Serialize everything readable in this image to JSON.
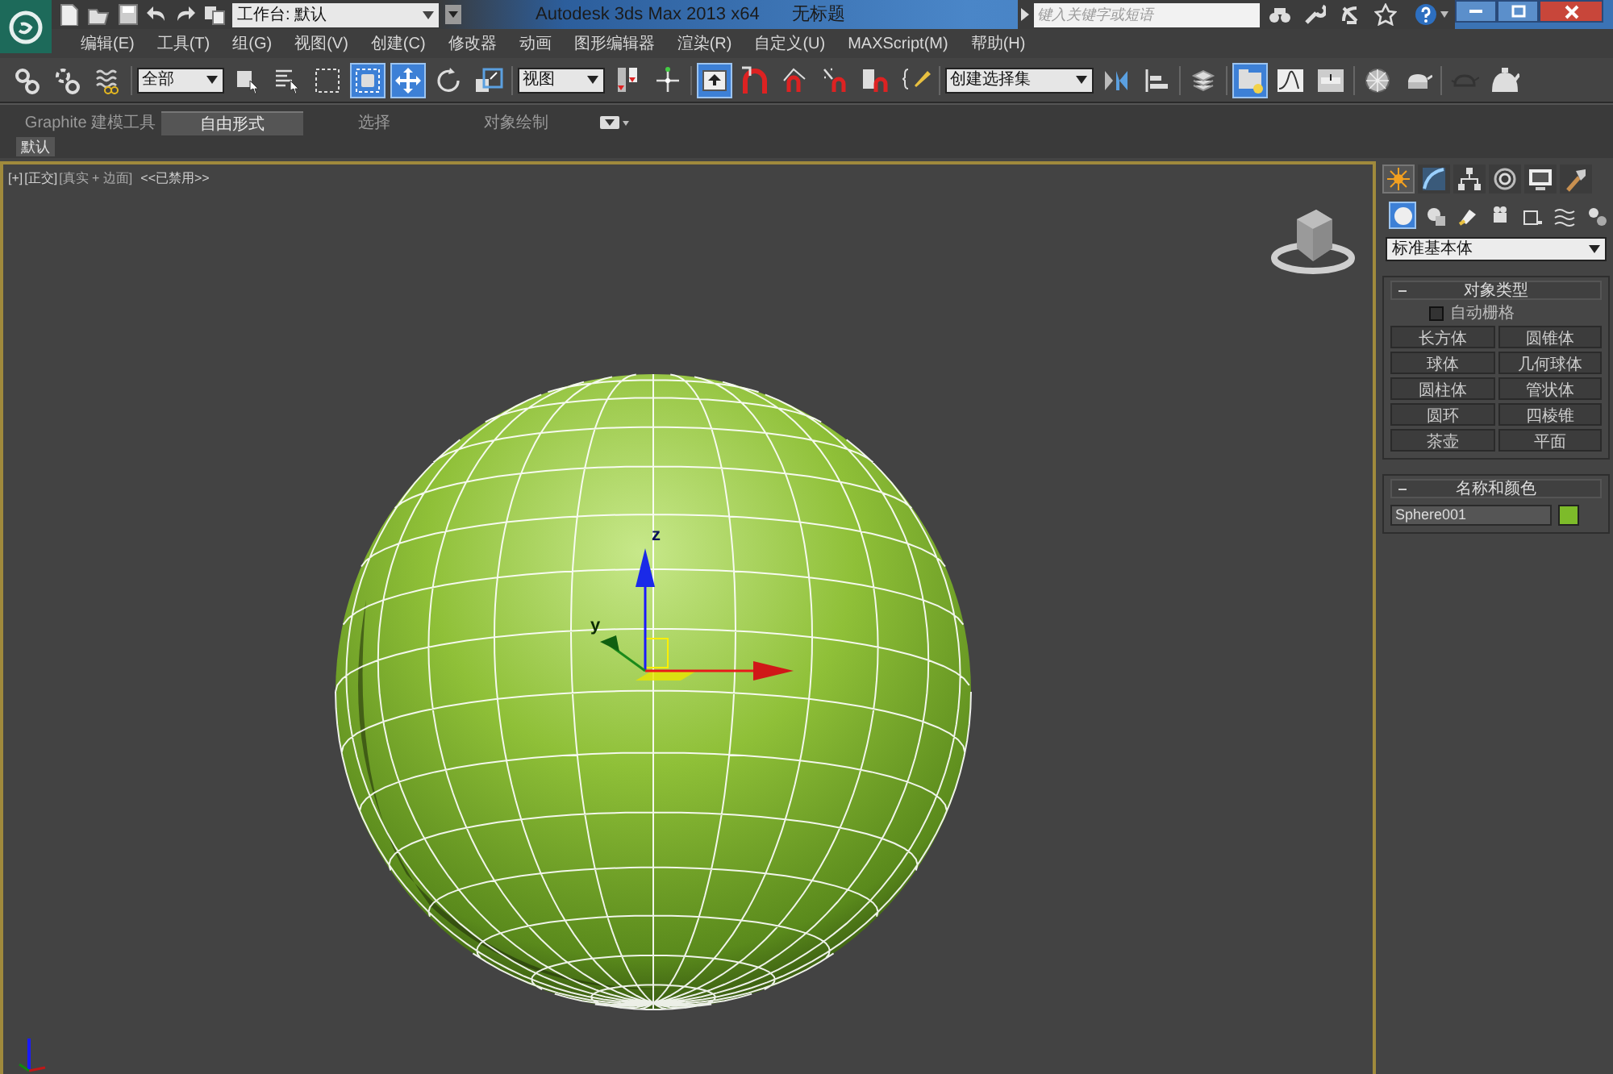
{
  "window": {
    "title": "Autodesk 3ds Max  2013 x64",
    "document": "无标题"
  },
  "quick_access": {
    "workspace": "工作台: 默认"
  },
  "search": {
    "placeholder": "键入关键字或短语"
  },
  "menu": [
    "编辑(E)",
    "工具(T)",
    "组(G)",
    "视图(V)",
    "创建(C)",
    "修改器",
    "动画",
    "图形编辑器",
    "渲染(R)",
    "自定义(U)",
    "MAXScript(M)",
    "帮助(H)"
  ],
  "toolbar": [
    {
      "kind": "button",
      "selected": false
    },
    {
      "kind": "button",
      "selected": false
    },
    {
      "kind": "button",
      "selected": false
    },
    {
      "kind": "dropdown",
      "value": "全部"
    },
    {
      "kind": "button",
      "selected": false
    },
    {
      "kind": "button",
      "selected": false
    },
    {
      "kind": "button",
      "selected": false
    },
    {
      "kind": "button",
      "selected": true
    },
    {
      "kind": "button",
      "selected": true
    },
    {
      "kind": "button",
      "selected": false
    },
    {
      "kind": "button",
      "selected": false
    },
    {
      "kind": "dropdown",
      "value": "视图"
    },
    {
      "kind": "button",
      "selected": false
    },
    {
      "kind": "button",
      "selected": false
    },
    {
      "kind": "button",
      "selected": true
    },
    {
      "kind": "button",
      "selected": false
    },
    {
      "kind": "button",
      "selected": false
    },
    {
      "kind": "button",
      "selected": false
    },
    {
      "kind": "button",
      "selected": false
    },
    {
      "kind": "button",
      "selected": false
    },
    {
      "kind": "dropdown",
      "value": "创建选择集"
    },
    {
      "kind": "button",
      "selected": false
    },
    {
      "kind": "button",
      "selected": false
    },
    {
      "kind": "button",
      "selected": false
    },
    {
      "kind": "button",
      "selected": true
    },
    {
      "kind": "button",
      "selected": false
    },
    {
      "kind": "button",
      "selected": false
    },
    {
      "kind": "button",
      "selected": false
    },
    {
      "kind": "button",
      "selected": false
    },
    {
      "kind": "button",
      "selected": false
    },
    {
      "kind": "button",
      "selected": false
    }
  ],
  "ribbon": {
    "tabs": [
      {
        "label": "Graphite 建模工具",
        "selected": false
      },
      {
        "label": "自由形式",
        "selected": true
      },
      {
        "label": "选择",
        "selected": false
      },
      {
        "label": "对象绘制",
        "selected": false
      }
    ],
    "subtabs": [
      {
        "label": "默认",
        "selected": true
      }
    ]
  },
  "viewport": {
    "labels": [
      "[+]",
      "[正交]",
      "[真实 + 边面]",
      "<<已禁用>>"
    ],
    "axis_labels": [
      "z",
      "y"
    ],
    "active": true
  },
  "command_panel": {
    "tabs": [
      {
        "selected": true
      },
      {
        "selected": false
      },
      {
        "selected": false
      },
      {
        "selected": false
      },
      {
        "selected": false
      },
      {
        "selected": false
      }
    ],
    "categories": [
      {
        "selected": true
      },
      {
        "selected": false
      },
      {
        "selected": false
      },
      {
        "selected": false
      },
      {
        "selected": false
      },
      {
        "selected": false
      },
      {
        "selected": false
      }
    ],
    "dropdown": "标准基本体",
    "rollouts": [
      {
        "title": "对象类型",
        "checkbox": {
          "label": "自动栅格",
          "checked": false
        },
        "buttons": [
          "长方体",
          "圆锥体",
          "球体",
          "几何球体",
          "圆柱体",
          "管状体",
          "圆环",
          "四棱锥",
          "茶壶",
          "平面"
        ]
      },
      {
        "title": "名称和颜色",
        "name": "Sphere001",
        "color": "#7dbb2a"
      }
    ]
  }
}
